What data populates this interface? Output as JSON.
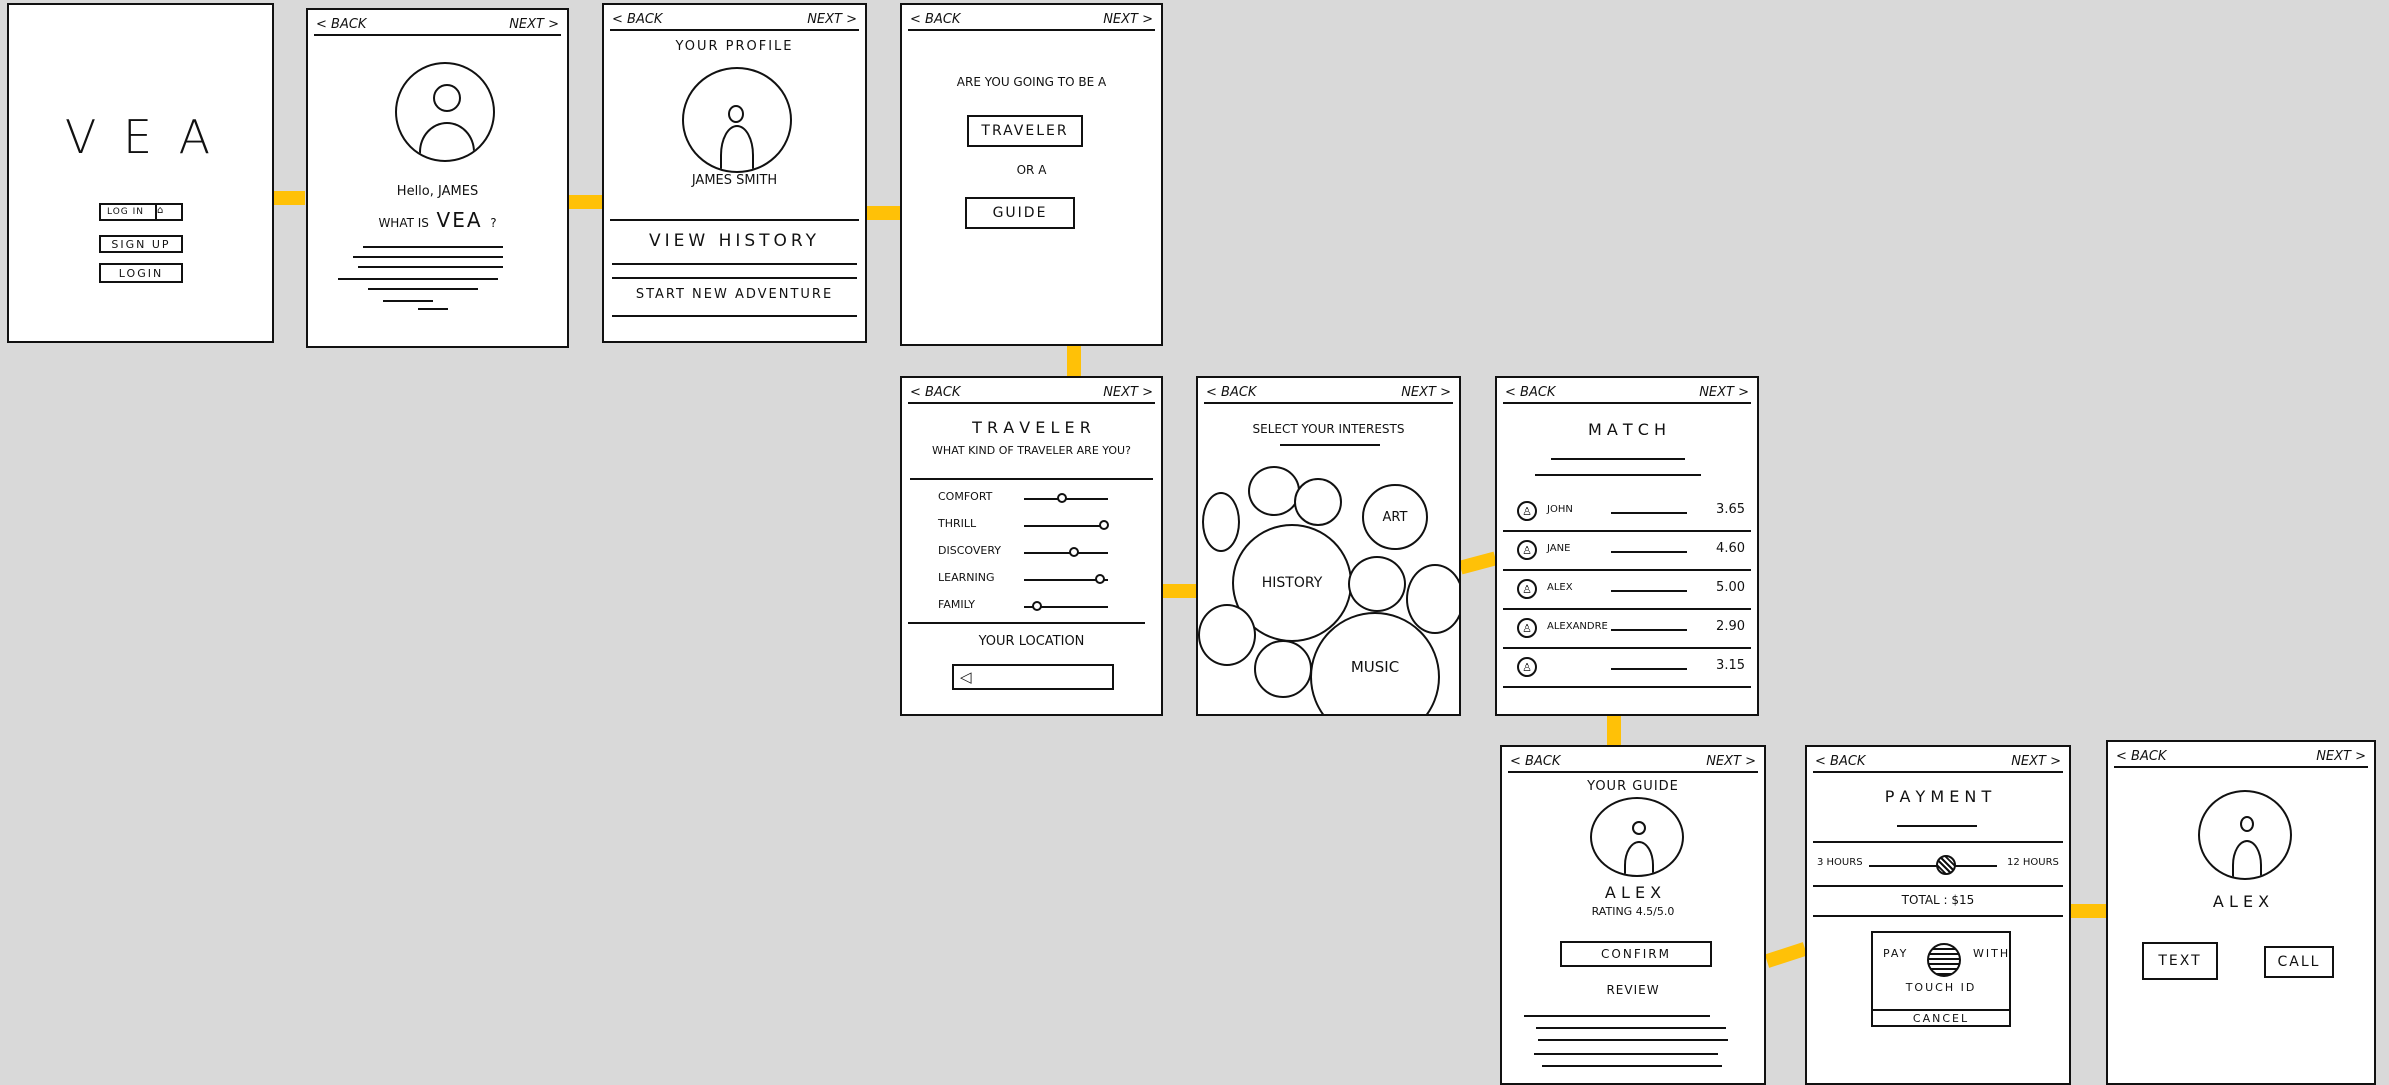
{
  "nav": {
    "back": "< BACK",
    "next": "NEXT >"
  },
  "screen1": {
    "logo": "V  E  A",
    "login_small": "LOG IN",
    "sign_up": "SIGN UP",
    "login": "LOGIN"
  },
  "screen2": {
    "greeting": "Hello, JAMES",
    "question_prefix": "WHAT IS",
    "question_brand": "VEA",
    "question_suffix": "?"
  },
  "screen3": {
    "title": "YOUR  PROFILE",
    "name": "JAMES  SMITH",
    "view_history": "VIEW   HISTORY",
    "start_adventure": "START  NEW  ADVENTURE"
  },
  "screen4": {
    "question": "ARE YOU GOING TO BE A",
    "traveler": "TRAVELER",
    "or": "OR A",
    "guide": "GUIDE"
  },
  "screen5": {
    "title": "T R A V E L E R",
    "subtitle": "WHAT KIND OF TRAVELER ARE YOU?",
    "sliders": [
      {
        "label": "COMFORT",
        "value": 0.45
      },
      {
        "label": "THRILL",
        "value": 0.95
      },
      {
        "label": "DISCOVERY",
        "value": 0.6
      },
      {
        "label": "LEARNING",
        "value": 0.9
      },
      {
        "label": "FAMILY",
        "value": 0.15
      }
    ],
    "location_label": "YOUR LOCATION"
  },
  "screen6": {
    "title": "SELECT YOUR INTERESTS",
    "art": "ART",
    "history": "HISTORY",
    "music": "MUSIC"
  },
  "screen7": {
    "title": "M A T C H",
    "rows": [
      {
        "name": "JOHN",
        "score": "3.65"
      },
      {
        "name": "JANE",
        "score": "4.60"
      },
      {
        "name": "ALEX",
        "score": "5.00"
      },
      {
        "name": "ALEXANDRE",
        "score": "2.90"
      },
      {
        "name": "",
        "score": "3.15"
      }
    ]
  },
  "screen8": {
    "title": "YOUR  GUIDE",
    "name": "A L E X",
    "rating": "RATING  4.5/5.0",
    "confirm": "CONFIRM",
    "review": "REVIEW"
  },
  "screen9": {
    "title": "P A Y  M E N T",
    "min_hours": "3 HOURS",
    "max_hours": "12 HOURS",
    "total": "TOTAL : $15",
    "pay_with": "PAY",
    "with": "WITH",
    "touch_id": "TOUCH  ID",
    "cancel": "CANCEL",
    "duration_fraction": 0.6
  },
  "screen10": {
    "name": "A L E X",
    "text": "TEXT",
    "call": "CALL"
  },
  "colors": {
    "connector": "#ffc107",
    "background": "#d9d9d9",
    "ink": "#111111"
  }
}
